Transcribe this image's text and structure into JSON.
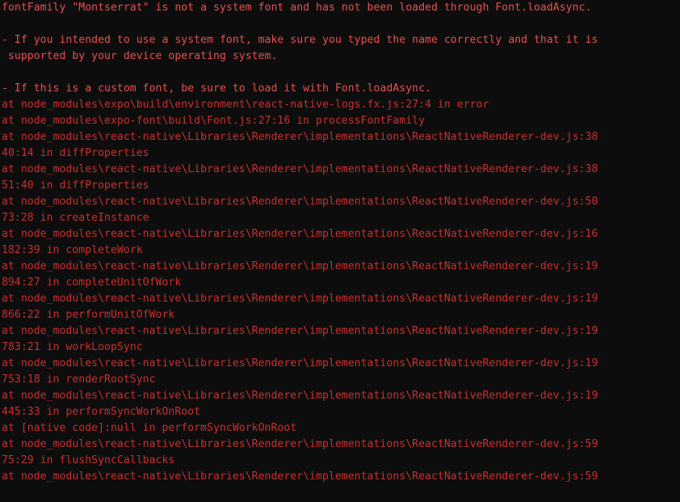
{
  "console": {
    "background_color": "#0d0d0d",
    "message_text_color": "#e8504f",
    "stack_text_color": "#c9302c",
    "message_lines": [
      "fontFamily \"Montserrat\" is not a system font and has not been loaded through Font.loadAsync.",
      "",
      "- If you intended to use a system font, make sure you typed the name correctly and that it is",
      " supported by your device operating system.",
      "",
      "- If this is a custom font, be sure to load it with Font.loadAsync."
    ],
    "stack_lines": [
      "at node_modules\\expo\\build\\environment\\react-native-logs.fx.js:27:4 in error",
      "at node_modules\\expo-font\\build\\Font.js:27:16 in processFontFamily",
      "at node_modules\\react-native\\Libraries\\Renderer\\implementations\\ReactNativeRenderer-dev.js:38",
      "40:14 in diffProperties",
      "at node_modules\\react-native\\Libraries\\Renderer\\implementations\\ReactNativeRenderer-dev.js:38",
      "51:40 in diffProperties",
      "at node_modules\\react-native\\Libraries\\Renderer\\implementations\\ReactNativeRenderer-dev.js:50",
      "73:28 in createInstance",
      "at node_modules\\react-native\\Libraries\\Renderer\\implementations\\ReactNativeRenderer-dev.js:16",
      "182:39 in completeWork",
      "at node_modules\\react-native\\Libraries\\Renderer\\implementations\\ReactNativeRenderer-dev.js:19",
      "894:27 in completeUnitOfWork",
      "at node_modules\\react-native\\Libraries\\Renderer\\implementations\\ReactNativeRenderer-dev.js:19",
      "866:22 in performUnitOfWork",
      "at node_modules\\react-native\\Libraries\\Renderer\\implementations\\ReactNativeRenderer-dev.js:19",
      "783:21 in workLoopSync",
      "at node_modules\\react-native\\Libraries\\Renderer\\implementations\\ReactNativeRenderer-dev.js:19",
      "753:18 in renderRootSync",
      "at node_modules\\react-native\\Libraries\\Renderer\\implementations\\ReactNativeRenderer-dev.js:19",
      "445:33 in performSyncWorkOnRoot",
      "at [native code]:null in performSyncWorkOnRoot",
      "at node_modules\\react-native\\Libraries\\Renderer\\implementations\\ReactNativeRenderer-dev.js:59",
      "75:29 in flushSyncCallbacks",
      "at node_modules\\react-native\\Libraries\\Renderer\\implementations\\ReactNativeRenderer-dev.js:59"
    ]
  }
}
